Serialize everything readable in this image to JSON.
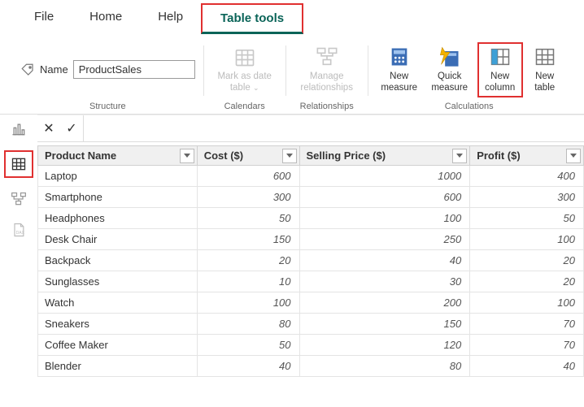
{
  "tabs": {
    "file": "File",
    "home": "Home",
    "help": "Help",
    "tabletools": "Table tools"
  },
  "structure": {
    "name_label": "Name",
    "name_value": "ProductSales",
    "group_label": "Structure"
  },
  "calendars": {
    "label": "Mark as date table",
    "group_label": "Calendars"
  },
  "relationships": {
    "label": "Manage relationships",
    "group_label": "Relationships"
  },
  "calculations": {
    "new_measure": "New measure",
    "quick_measure": "Quick measure",
    "new_column": "New column",
    "new_table": "New table",
    "group_label": "Calculations"
  },
  "table": {
    "headers": {
      "product": "Product Name",
      "cost": "Cost ($)",
      "sell": "Selling Price ($)",
      "profit": "Profit ($)"
    },
    "rows": [
      {
        "product": "Laptop",
        "cost": "600",
        "sell": "1000",
        "profit": "400"
      },
      {
        "product": "Smartphone",
        "cost": "300",
        "sell": "600",
        "profit": "300"
      },
      {
        "product": "Headphones",
        "cost": "50",
        "sell": "100",
        "profit": "50"
      },
      {
        "product": "Desk Chair",
        "cost": "150",
        "sell": "250",
        "profit": "100"
      },
      {
        "product": "Backpack",
        "cost": "20",
        "sell": "40",
        "profit": "20"
      },
      {
        "product": "Sunglasses",
        "cost": "10",
        "sell": "30",
        "profit": "20"
      },
      {
        "product": "Watch",
        "cost": "100",
        "sell": "200",
        "profit": "100"
      },
      {
        "product": "Sneakers",
        "cost": "80",
        "sell": "150",
        "profit": "70"
      },
      {
        "product": "Coffee Maker",
        "cost": "50",
        "sell": "120",
        "profit": "70"
      },
      {
        "product": "Blender",
        "cost": "40",
        "sell": "80",
        "profit": "40"
      }
    ]
  }
}
